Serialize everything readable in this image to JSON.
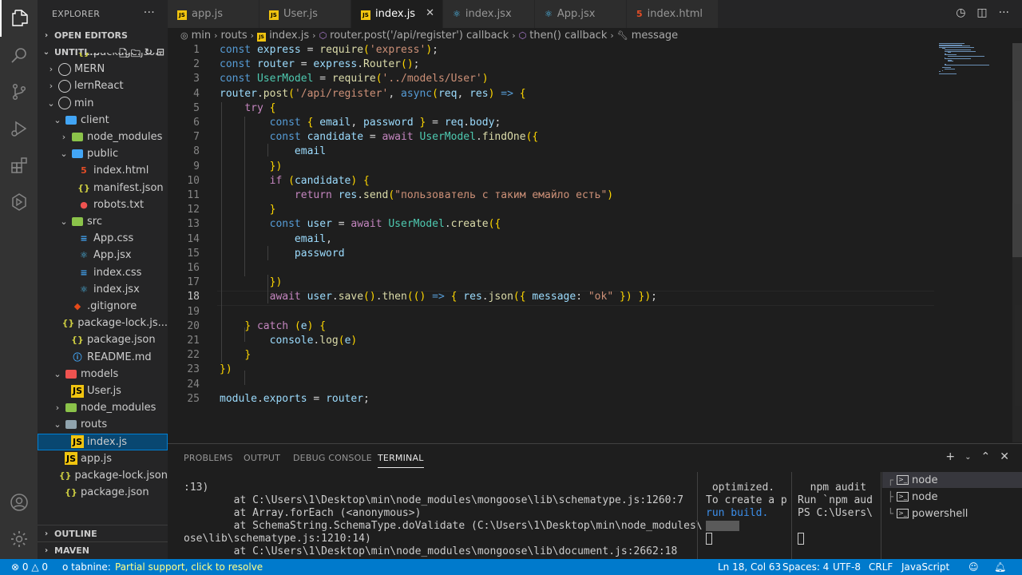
{
  "sidebar": {
    "title": "EXPLORER",
    "open_editors": "OPEN EDITORS",
    "workspace": "UNTITL...",
    "outline": "OUTLINE",
    "maven": "MAVEN",
    "tree": [
      {
        "label": "package.json",
        "indent": 4,
        "icon": "json"
      },
      {
        "label": "MERN",
        "indent": 1,
        "icon": "round",
        "chevron": ">"
      },
      {
        "label": "lernReact",
        "indent": 1,
        "icon": "round",
        "chevron": ">"
      },
      {
        "label": "min",
        "indent": 1,
        "icon": "round",
        "chevron": "v"
      },
      {
        "label": "client",
        "indent": 2,
        "icon": "folder-blue",
        "chevron": "v"
      },
      {
        "label": "node_modules",
        "indent": 3,
        "icon": "folder-green",
        "chevron": ">"
      },
      {
        "label": "public",
        "indent": 3,
        "icon": "folder-blue",
        "chevron": "v"
      },
      {
        "label": "index.html",
        "indent": 4,
        "icon": "html"
      },
      {
        "label": "manifest.json",
        "indent": 4,
        "icon": "json-braces"
      },
      {
        "label": "robots.txt",
        "indent": 4,
        "icon": "robot"
      },
      {
        "label": "src",
        "indent": 3,
        "icon": "folder-green",
        "chevron": "v"
      },
      {
        "label": "App.css",
        "indent": 4,
        "icon": "css"
      },
      {
        "label": "App.jsx",
        "indent": 4,
        "icon": "react"
      },
      {
        "label": "index.css",
        "indent": 4,
        "icon": "css"
      },
      {
        "label": "index.jsx",
        "indent": 4,
        "icon": "react"
      },
      {
        "label": ".gitignore",
        "indent": 3,
        "icon": "git"
      },
      {
        "label": "package-lock.js...",
        "indent": 3,
        "icon": "json"
      },
      {
        "label": "package.json",
        "indent": 3,
        "icon": "json"
      },
      {
        "label": "README.md",
        "indent": 3,
        "icon": "md"
      },
      {
        "label": "models",
        "indent": 2,
        "icon": "folder-red",
        "chevron": "v"
      },
      {
        "label": "User.js",
        "indent": 3,
        "icon": "js"
      },
      {
        "label": "node_modules",
        "indent": 2,
        "icon": "folder-green",
        "chevron": ">"
      },
      {
        "label": "routs",
        "indent": 2,
        "icon": "folder-grey",
        "chevron": "v"
      },
      {
        "label": "index.js",
        "indent": 3,
        "icon": "js",
        "selected": true
      },
      {
        "label": "app.js",
        "indent": 2,
        "icon": "js"
      },
      {
        "label": "package-lock.json",
        "indent": 2,
        "icon": "json"
      },
      {
        "label": "package.json",
        "indent": 2,
        "icon": "json"
      }
    ]
  },
  "tabs": [
    {
      "label": "app.js",
      "icon": "JS"
    },
    {
      "label": "User.js",
      "icon": "JS"
    },
    {
      "label": "index.js",
      "icon": "JS",
      "active": true
    },
    {
      "label": "index.jsx",
      "icon": "react"
    },
    {
      "label": "App.jsx",
      "icon": "react"
    },
    {
      "label": "index.html",
      "icon": "html"
    }
  ],
  "breadcrumb": {
    "parts": [
      "min",
      "routs",
      "index.js",
      "router.post('/api/register') callback",
      "then() callback",
      "message"
    ]
  },
  "editor": {
    "current_line": 18,
    "lines": [
      "const express = require('express');",
      "const router = express.Router();",
      "const UserModel = require('../models/User')",
      "router.post('/api/register', async(req, res) => {",
      "    try {",
      "        const { email, password } = req.body;",
      "        const candidate = await UserModel.findOne({",
      "            email",
      "        })",
      "        if (candidate) {",
      "            return res.send(\"пользователь с таким емайло есть\")",
      "        }",
      "        const user = await UserModel.create({",
      "            email,",
      "            password",
      "",
      "        })",
      "        await user.save().then(() => { res.json({ message: \"ok\" }) });",
      "",
      "    } catch (e) {",
      "        console.log(e)",
      "    }",
      "})",
      "",
      "module.exports = router;"
    ]
  },
  "panel": {
    "tabs": [
      "PROBLEMS",
      "OUTPUT",
      "DEBUG CONSOLE",
      "TERMINAL"
    ],
    "active_tab": "TERMINAL",
    "terminal1": [
      ":13)",
      "        at C:\\Users\\1\\Desktop\\min\\node_modules\\mongoose\\lib\\schematype.js:1260:7",
      "        at Array.forEach (<anonymous>)",
      "        at SchemaString.SchemaType.doValidate (C:\\Users\\1\\Desktop\\min\\node_modules\\mongo",
      "ose\\lib\\schematype.js:1210:14)",
      "        at C:\\Users\\1\\Desktop\\min\\node_modules\\mongoose\\lib\\document.js:2662:18"
    ],
    "terminal2": [
      " optimized.",
      "To create a p",
      "run build."
    ],
    "terminal3": [
      "  npm audit",
      "",
      "Run `npm aud",
      "PS C:\\Users\\"
    ],
    "terminal_list": [
      {
        "label": "node",
        "selected": true
      },
      {
        "label": "node"
      },
      {
        "label": "powershell"
      }
    ]
  },
  "statusbar": {
    "errors": "0",
    "warnings": "0",
    "tabnine": "tabnine:",
    "tabnine_msg": "Partial support, click to resolve",
    "position": "Ln 18, Col 63",
    "spaces": "Spaces: 4",
    "encoding": "UTF-8",
    "eol": "CRLF",
    "language": "JavaScript"
  }
}
